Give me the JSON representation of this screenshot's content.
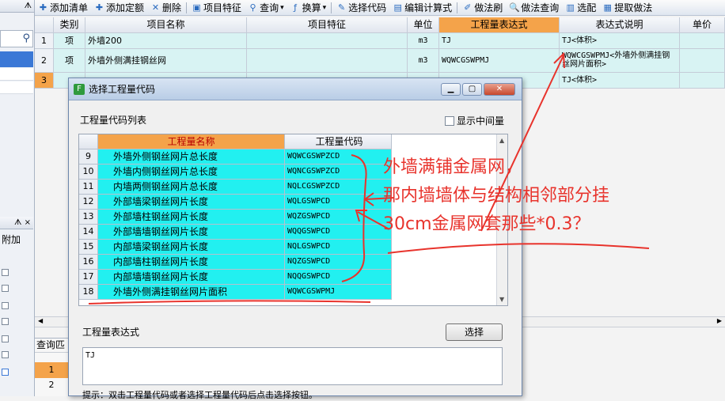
{
  "toolbar": {
    "items": [
      {
        "icon": "add-list-icon",
        "label": "添加清单"
      },
      {
        "icon": "add-quota-icon",
        "label": "添加定额"
      },
      {
        "icon": "close-icon",
        "label": "删除"
      },
      {
        "icon": "feature-icon",
        "label": "项目特征"
      },
      {
        "icon": "search-icon",
        "label": "查询"
      },
      {
        "icon": "convert-icon",
        "label": "换算"
      },
      {
        "icon": "code-select-icon",
        "label": "选择代码"
      },
      {
        "icon": "edit-formula-icon",
        "label": "编辑计算式"
      },
      {
        "icon": "method-brush-icon",
        "label": "做法刷"
      },
      {
        "icon": "method-query-icon",
        "label": "做法查询"
      },
      {
        "icon": "match-icon",
        "label": "选配"
      },
      {
        "icon": "extract-icon",
        "label": "提取做法"
      }
    ]
  },
  "grid": {
    "headers": [
      "类别",
      "项目名称",
      "项目特征",
      "单位",
      "工程量表达式",
      "表达式说明",
      "单价"
    ],
    "rows": [
      {
        "no": "1",
        "type": "项",
        "name": "外墙200",
        "feature": "",
        "unit": "m3",
        "expr": "TJ",
        "desc": "TJ<体积>"
      },
      {
        "no": "2",
        "type": "项",
        "name": "外墙外侧满挂钢丝网",
        "feature": "",
        "unit": "m3",
        "expr": "WQWCGSWPMJ",
        "desc": "WQWCGSWPMJ<外墙外侧满挂钢丝网片面积>"
      },
      {
        "no": "3",
        "type": "",
        "name": "",
        "feature": "",
        "unit": "",
        "expr": "",
        "desc": "TJ<体积>"
      }
    ]
  },
  "left_panel": {
    "pin1": "ᗑ",
    "pin2": "ᗑ ×",
    "label1": "附加"
  },
  "bottom_panel": {
    "tab_label": "查询匹",
    "row1": "1",
    "row2": "2"
  },
  "dialog": {
    "title": "选择工程量代码",
    "list_label": "工程量代码列表",
    "checkbox_label": "显示中间量",
    "col_name": "工程量名称",
    "col_code": "工程量代码",
    "rows": [
      {
        "no": "9",
        "name": "外墙外侧钢丝网片总长度",
        "code": "WQWCGSWPZCD"
      },
      {
        "no": "10",
        "name": "外墙内侧钢丝网片总长度",
        "code": "WQNCGSWPZCD"
      },
      {
        "no": "11",
        "name": "内墙两侧钢丝网片总长度",
        "code": "NQLCGSWPZCD"
      },
      {
        "no": "12",
        "name": "外部墙梁钢丝网片长度",
        "code": "WQLGSWPCD"
      },
      {
        "no": "13",
        "name": "外部墙柱钢丝网片长度",
        "code": "WQZGSWPCD"
      },
      {
        "no": "14",
        "name": "外部墙墙钢丝网片长度",
        "code": "WQQGSWPCD"
      },
      {
        "no": "15",
        "name": "内部墙梁钢丝网片长度",
        "code": "NQLGSWPCD"
      },
      {
        "no": "16",
        "name": "内部墙柱钢丝网片长度",
        "code": "NQZGSWPCD"
      },
      {
        "no": "17",
        "name": "内部墙墙钢丝网片长度",
        "code": "NQQGSWPCD"
      },
      {
        "no": "18",
        "name": "外墙外侧满挂钢丝网片面积",
        "code": "WQWCGSWPMJ"
      }
    ],
    "expr_label": "工程量表达式",
    "select_button": "选择",
    "expr_value": "TJ",
    "hint": "提示：双击工程量代码或者选择工程量代码后点击选择按钮。"
  },
  "annotation": {
    "line1": "外墙满铺金属网，",
    "line2": "那内墙墙体与结构相邻部分挂",
    "line3": "30cm金属网套那些*0.3？",
    "color": "#e8332c"
  }
}
